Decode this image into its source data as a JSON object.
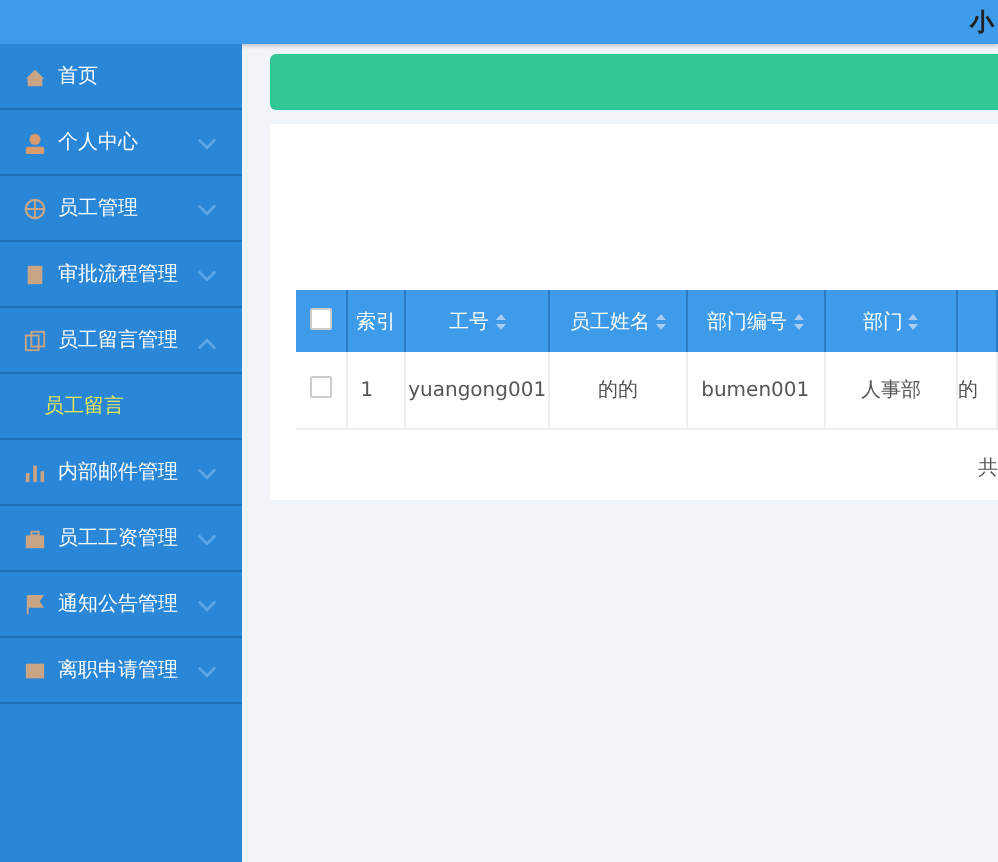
{
  "header": {
    "title": "小"
  },
  "sidebar": {
    "items": [
      {
        "label": "首页"
      },
      {
        "label": "个人中心",
        "expanded": false
      },
      {
        "label": "员工管理",
        "expanded": false
      },
      {
        "label": "审批流程管理",
        "expanded": false
      },
      {
        "label": "员工留言管理",
        "expanded": true,
        "children": [
          {
            "label": "员工留言",
            "selected": true
          }
        ]
      },
      {
        "label": "内部邮件管理",
        "expanded": false
      },
      {
        "label": "员工工资管理",
        "expanded": false
      },
      {
        "label": "通知公告管理",
        "expanded": false
      },
      {
        "label": "离职申请管理",
        "expanded": false
      }
    ]
  },
  "table": {
    "all_checked": false,
    "columns": [
      {
        "label": "索引",
        "kind": "plain"
      },
      {
        "label": "工号",
        "kind": "sortable"
      },
      {
        "label": "员工姓名",
        "kind": "sortable"
      },
      {
        "label": "部门编号",
        "kind": "sortable"
      },
      {
        "label": "部门",
        "kind": "sortable"
      },
      {
        "kind": "plain"
      }
    ],
    "rows": [
      {
        "checked": false,
        "cells": [
          "1",
          "yuangong001",
          "的的",
          "bumen001",
          "人事部",
          "的"
        ]
      }
    ]
  },
  "pagination": {
    "text": "共"
  }
}
